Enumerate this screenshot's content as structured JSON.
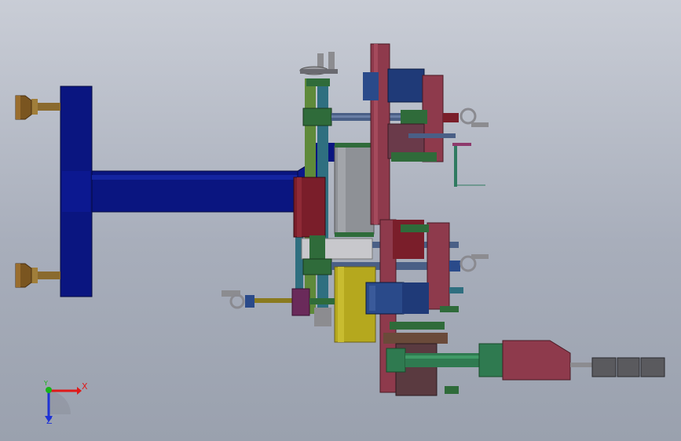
{
  "viewport": {
    "colors": {
      "background_top": "#c9cdd6",
      "background_bottom": "#9aa1ae",
      "frame_blue": "#0a1580",
      "gray_cylinder": "#8e9196",
      "maroon": "#8e3a4c",
      "dark_red": "#7a1e2a",
      "green": "#2f6b3a",
      "olive_yellow": "#b5a81e",
      "teal": "#2f6f80",
      "steel_blue": "#3f5f8e",
      "brass": "#8a5a1e",
      "dark_gray": "#3a3a3a"
    }
  },
  "triad": {
    "x_label": "X",
    "y_label": "Y",
    "z_label": "Z",
    "x_color": "#e01919",
    "y_color": "#19b319",
    "z_color": "#1f33d6"
  }
}
